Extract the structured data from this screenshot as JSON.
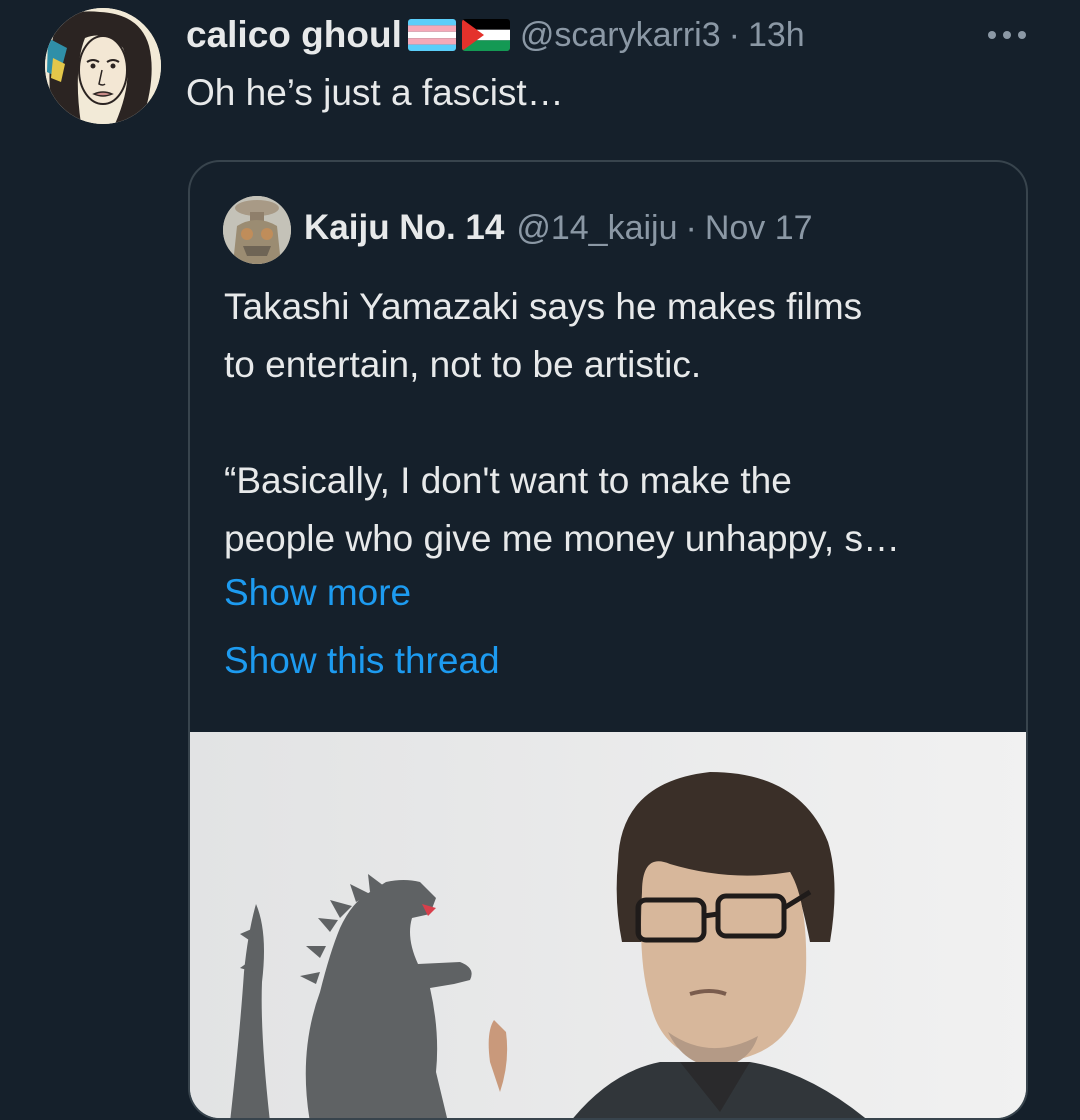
{
  "tweet": {
    "author": {
      "display_name": "calico ghoul",
      "flags": [
        "transgender-flag-icon",
        "palestine-flag-icon"
      ],
      "handle": "@scarykarri3",
      "separator": "·",
      "time": "13h"
    },
    "text": "Oh he’s just a fascist…",
    "more_icon": "more-horizontal-icon"
  },
  "quote": {
    "author": {
      "display_name": "Kaiju No. 14",
      "handle": "@14_kaiju",
      "separator": "·",
      "date": "Nov 17"
    },
    "text": "Takashi Yamazaki says he makes films\nto entertain, not to be artistic.\n\n“Basically, I don't want to make the\npeople who give me money unhappy, s…",
    "show_more": "Show more",
    "show_thread": "Show this thread",
    "media_description_icon": "photo-icon"
  },
  "colors": {
    "background": "#15202b",
    "text_primary": "#e7e9ea",
    "text_secondary": "#8b98a5",
    "link": "#1d9bf0",
    "border": "#38444d"
  }
}
